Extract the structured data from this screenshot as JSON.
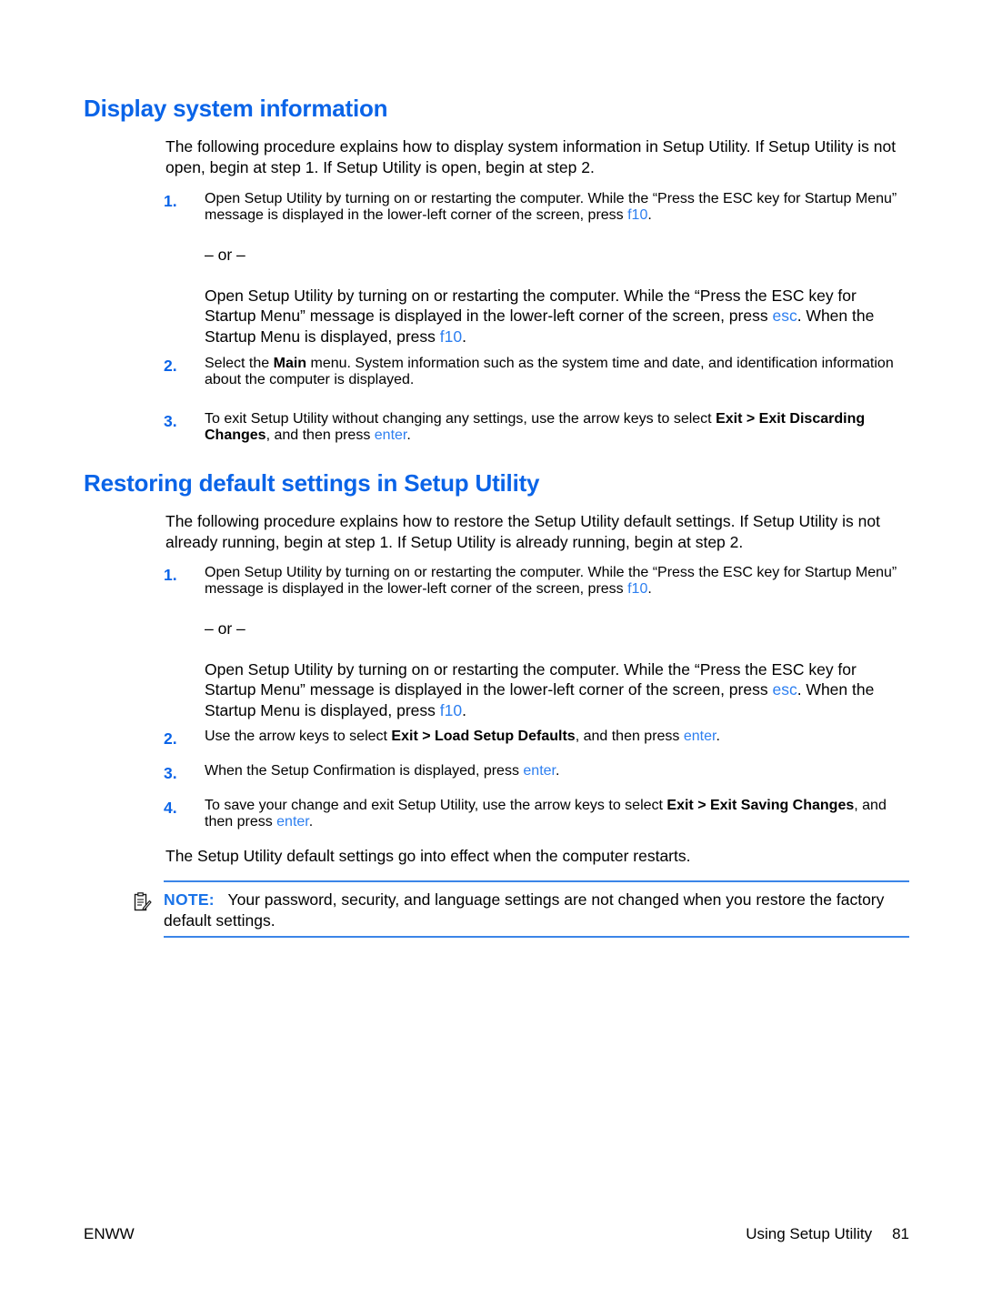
{
  "document": {
    "sections": [
      {
        "heading": "Display system information",
        "intro": "The following procedure explains how to display system information in Setup Utility. If Setup Utility is not open, begin at step 1. If Setup Utility is open, begin at step 2.",
        "steps": [
          {
            "number": "1.",
            "part_a_pre": "Open Setup Utility by turning on or restarting the computer. While the “Press the ESC key for Startup Menu” message is displayed in the lower-left corner of the screen, press ",
            "part_a_key": "f10",
            "part_a_post": ".",
            "or_separator": "– or –",
            "part_b_pre": "Open Setup Utility by turning on or restarting the computer. While the “Press the ESC key for Startup Menu” message is displayed in the lower-left corner of the screen, press ",
            "part_b_key1": "esc",
            "part_b_mid": ". When the Startup Menu is displayed, press ",
            "part_b_key2": "f10",
            "part_b_post": "."
          },
          {
            "number": "2.",
            "pre": "Select the ",
            "bold1": "Main",
            "post": " menu. System information such as the system time and date, and identification information about the computer is displayed."
          },
          {
            "number": "3.",
            "pre": "To exit Setup Utility without changing any settings, use the arrow keys to select ",
            "bold1": "Exit > Exit Discarding Changes",
            "mid": ", and then press ",
            "key": "enter",
            "post": "."
          }
        ]
      },
      {
        "heading": "Restoring default settings in Setup Utility",
        "intro": "The following procedure explains how to restore the Setup Utility default settings. If Setup Utility is not already running, begin at step 1. If Setup Utility is already running, begin at step 2.",
        "steps": [
          {
            "number": "1.",
            "part_a_pre": "Open Setup Utility by turning on or restarting the computer. While the “Press the ESC key for Startup Menu” message is displayed in the lower-left corner of the screen, press ",
            "part_a_key": "f10",
            "part_a_post": ".",
            "or_separator": "– or –",
            "part_b_pre": "Open Setup Utility by turning on or restarting the computer. While the “Press the ESC key for Startup Menu” message is displayed in the lower-left corner of the screen, press ",
            "part_b_key1": "esc",
            "part_b_mid": ". When the Startup Menu is displayed, press ",
            "part_b_key2": "f10",
            "part_b_post": "."
          },
          {
            "number": "2.",
            "pre": "Use the arrow keys to select ",
            "bold1": "Exit > Load Setup Defaults",
            "mid": ", and then press ",
            "key": "enter",
            "post": "."
          },
          {
            "number": "3.",
            "pre": "When the Setup Confirmation is displayed, press ",
            "key": "enter",
            "post": "."
          },
          {
            "number": "4.",
            "pre": "To save your change and exit Setup Utility, use the arrow keys to select ",
            "bold1": "Exit > Exit Saving Changes",
            "mid": ", and then press ",
            "key": "enter",
            "post": "."
          }
        ],
        "closing": "The Setup Utility default settings go into effect when the computer restarts."
      }
    ],
    "note": {
      "icon": "note-clipboard-icon",
      "label": "NOTE:",
      "text": "Your password, security, and language settings are not changed when you restore the factory default settings."
    },
    "footer": {
      "left": "ENWW",
      "right": "Using Setup Utility",
      "page_number": "81"
    },
    "colors": {
      "heading_blue": "#0a64e8",
      "key_blue": "#2d7ff0",
      "note_rule_blue": "#3b85e8",
      "note_label_blue": "#1a73e8",
      "text_black": "#000000",
      "page_background": "#ffffff"
    }
  }
}
